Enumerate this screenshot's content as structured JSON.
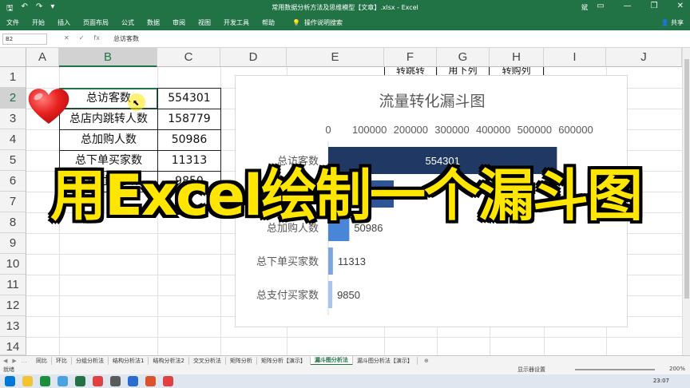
{
  "window": {
    "title": "常用数据分析方法及思维模型【文章】.xlsx - Excel",
    "user": "斌",
    "restore_icon": "restore-icon",
    "minimize_icon": "minimize-icon",
    "close_icon": "close-icon"
  },
  "ribbon": {
    "tabs": [
      "文件",
      "开始",
      "插入",
      "页面布局",
      "公式",
      "数据",
      "审阅",
      "视图",
      "开发工具",
      "帮助"
    ],
    "tell_me": "操作说明搜索",
    "share": "共享"
  },
  "formula_bar": {
    "name_box": "B2",
    "fx": "fx",
    "value": "总访客数"
  },
  "sheet": {
    "columns": [
      "A",
      "B",
      "C",
      "D",
      "E",
      "F",
      "G",
      "H",
      "I",
      "J"
    ],
    "rows": [
      "1",
      "2",
      "3",
      "4",
      "5",
      "6",
      "7",
      "8",
      "9",
      "10",
      "11",
      "12",
      "13",
      "14"
    ],
    "table": [
      {
        "label": "总访客数",
        "value": "554301"
      },
      {
        "label": "总店内跳转人数",
        "value": "158779"
      },
      {
        "label": "总加购人数",
        "value": "50986"
      },
      {
        "label": "总下单买家数",
        "value": "11313"
      },
      {
        "label": "总支付买家数",
        "value": "9850"
      }
    ],
    "partial_headers": [
      "转跳转",
      "用下列",
      "转购列"
    ]
  },
  "chart_data": {
    "type": "bar",
    "title": "流量转化漏斗图",
    "categories": [
      "总访客数",
      "总店内跳转人数",
      "总加购人数",
      "总下单买家数",
      "总支付买家数"
    ],
    "values": [
      554301,
      158779,
      50986,
      11313,
      9850
    ],
    "data_labels": [
      "554301",
      "158779",
      "50986",
      "11313",
      "9850"
    ],
    "x_ticks": [
      "0",
      "100000",
      "200000",
      "300000",
      "400000",
      "500000",
      "600000"
    ],
    "xlim": [
      0,
      600000
    ],
    "colors": [
      "#1f3864",
      "#2f5597",
      "#4a86d8",
      "#7aa6e3",
      "#a9c4ee"
    ]
  },
  "overlay": {
    "caption": "用Excel绘制一个漏斗图",
    "caption_color": "#ffe600"
  },
  "sheet_tabs": {
    "tabs": [
      "同比",
      "环比",
      "分组分析法",
      "结构分析法1",
      "结构分析法2",
      "交叉分析法",
      "矩阵分析",
      "矩阵分析【演示】",
      "漏斗图分析法",
      "漏斗图分析法【演示】"
    ],
    "active_index": 8,
    "more": "..."
  },
  "status": {
    "ready": "就绪",
    "display_settings": "显示器设置",
    "zoom": "200%"
  },
  "taskbar": {
    "time": "23:07"
  }
}
